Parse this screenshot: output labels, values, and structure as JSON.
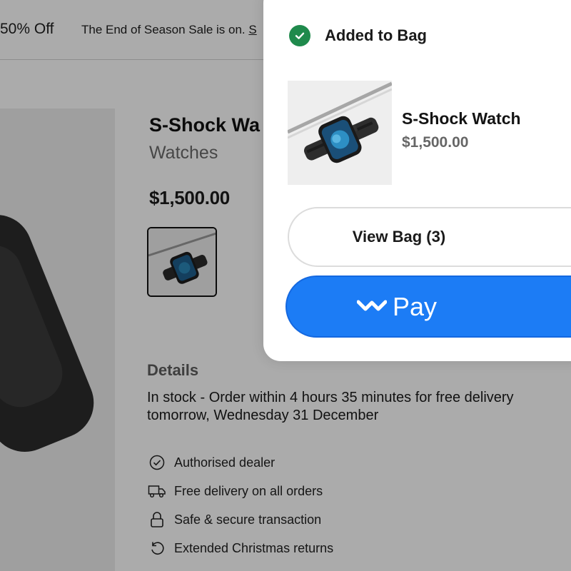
{
  "promo": {
    "discount": "50% Off",
    "message_prefix": "The End of Season Sale is on. ",
    "message_link": "S"
  },
  "product": {
    "title": "S-Shock Wa",
    "category": "Watches",
    "price": "$1,500.00"
  },
  "details": {
    "heading": "Details",
    "stock_text": "In stock - Order within 4 hours 35 minutes for free delivery tomorrow, Wednesday 31 December"
  },
  "features": [
    {
      "icon": "check-circle-icon",
      "label": "Authorised dealer"
    },
    {
      "icon": "truck-icon",
      "label": "Free delivery on all orders"
    },
    {
      "icon": "lock-icon",
      "label": "Safe & secure transaction"
    },
    {
      "icon": "return-icon",
      "label": "Extended Christmas returns"
    }
  ],
  "bag_panel": {
    "status": "Added to Bag",
    "item_name": "S-Shock Watch",
    "item_price": "$1,500.00",
    "view_bag_label": "View Bag (3)",
    "pay_label": "Pay"
  },
  "colors": {
    "success": "#1f8a4c",
    "pay_blue": "#1c7cf5"
  }
}
